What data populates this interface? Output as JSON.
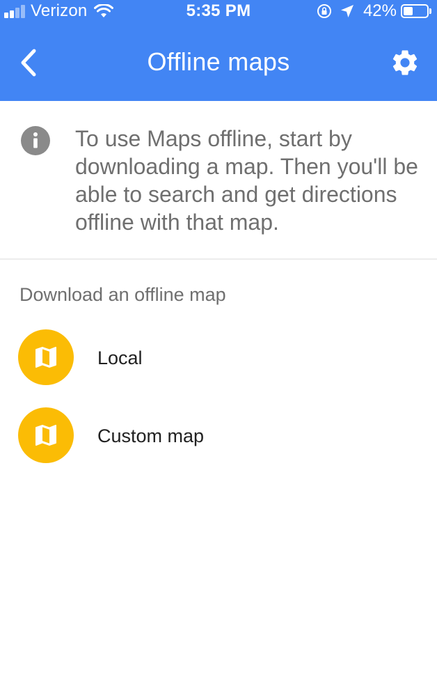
{
  "status_bar": {
    "carrier": "Verizon",
    "time": "5:35 PM",
    "battery_percent": "42%",
    "battery_level": 0.42,
    "signal_bars_filled": 2,
    "signal_bars_total": 4
  },
  "header": {
    "title": "Offline maps",
    "background_color": "#4285f4",
    "back_icon": "chevron-left-icon",
    "settings_icon": "gear-icon"
  },
  "info": {
    "icon": "info-icon",
    "text": "To use Maps offline, start by downloading a map. Then you'll be able to search and get directions offline with that map."
  },
  "download_section": {
    "title": "Download an offline map",
    "icon_color": "#fbbc05",
    "options": [
      {
        "label": "Local",
        "icon": "map-icon"
      },
      {
        "label": "Custom map",
        "icon": "map-icon"
      }
    ]
  }
}
